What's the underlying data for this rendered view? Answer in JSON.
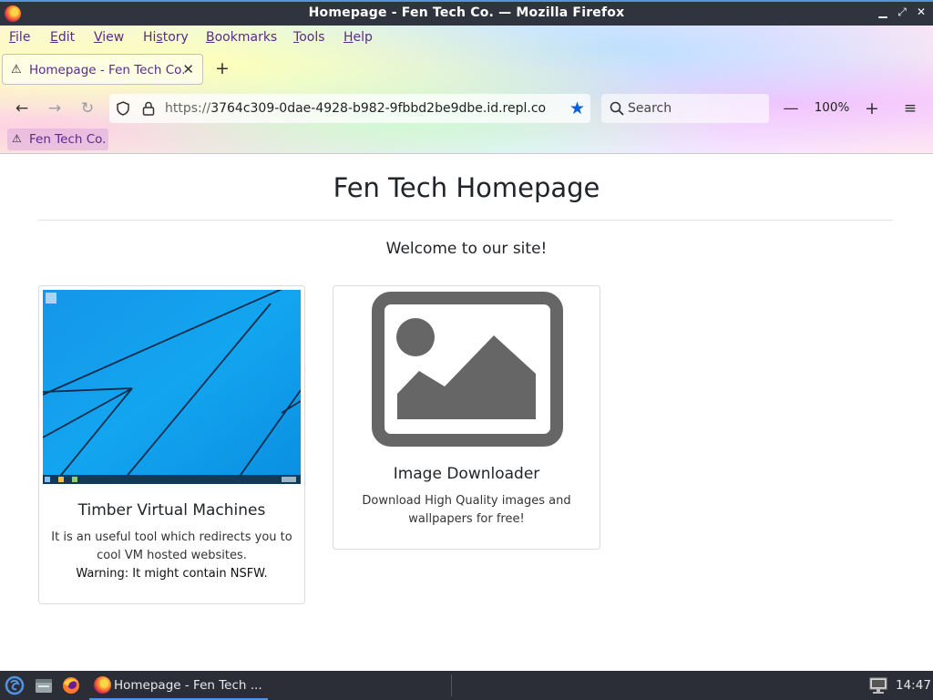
{
  "window": {
    "title": "Homepage - Fen Tech Co. — Mozilla Firefox",
    "controls": {
      "minimize": "▁",
      "maximize": "⤢",
      "close": "✕"
    }
  },
  "menubar": {
    "items": [
      {
        "pre": "",
        "u": "F",
        "post": "ile"
      },
      {
        "pre": "",
        "u": "E",
        "post": "dit"
      },
      {
        "pre": "",
        "u": "V",
        "post": "iew"
      },
      {
        "pre": "Hi",
        "u": "s",
        "post": "tory"
      },
      {
        "pre": "",
        "u": "B",
        "post": "ookmarks"
      },
      {
        "pre": "",
        "u": "T",
        "post": "ools"
      },
      {
        "pre": "",
        "u": "H",
        "post": "elp"
      }
    ]
  },
  "tab": {
    "label": "Homepage - Fen Tech Co.",
    "close": "✕"
  },
  "new_tab": "+",
  "nav": {
    "back": "←",
    "forward": "→",
    "reload": "↻",
    "url_scheme": "https://",
    "url_rest": "3764c309-0dae-4928-b982-9fbbd2be9dbe.id.repl.co",
    "bookmark_star": "★",
    "search_placeholder": "Search",
    "zoom_out": "—",
    "zoom_level": "100%",
    "zoom_in": "+",
    "menu": "≡"
  },
  "bookmarks": [
    {
      "label": "Fen Tech Co."
    }
  ],
  "page": {
    "title": "Fen Tech Homepage",
    "welcome": "Welcome to our site!",
    "cards": [
      {
        "title": "Timber Virtual Machines",
        "text": "It is an useful tool which redirects you to cool VM hosted websites.",
        "warning": "Warning: It might contain NSFW."
      },
      {
        "title": "Image Downloader",
        "text": "Download High Quality images and wallpapers for free!"
      }
    ]
  },
  "taskbar": {
    "task_label": "Homepage - Fen Tech ...",
    "clock": "14:47"
  },
  "colors": {
    "titlebar": "#2f343f",
    "accent": "#5294e2",
    "menu_text": "#5a2a8a",
    "taskbar": "#2b2e37",
    "star": "#0a60d8",
    "placeholder_gray": "#666666"
  }
}
